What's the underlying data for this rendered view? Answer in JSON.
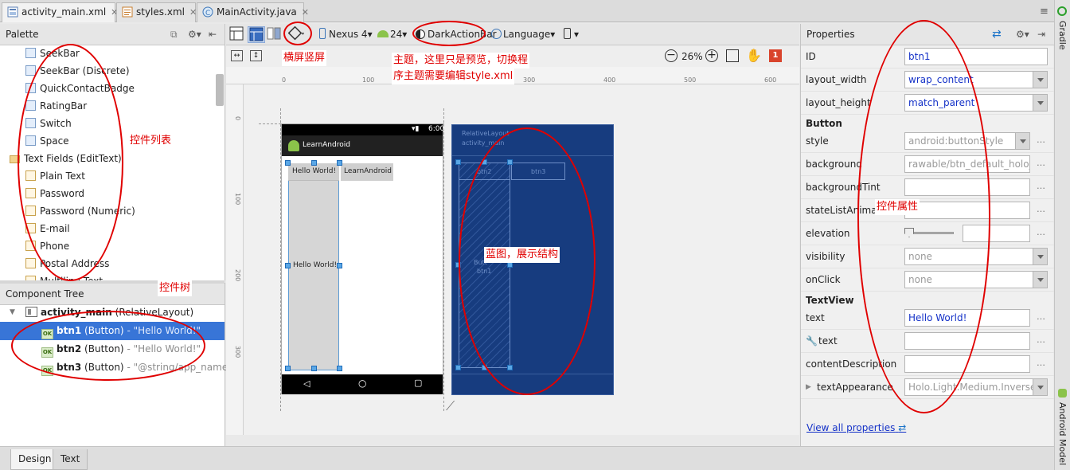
{
  "tabs": [
    {
      "label": "activity_main.xml",
      "icon": "layout-file-icon",
      "active": true
    },
    {
      "label": "styles.xml",
      "icon": "xml-file-icon",
      "active": false
    },
    {
      "label": "MainActivity.java",
      "icon": "java-class-icon",
      "active": false
    }
  ],
  "palette": {
    "title": "Palette",
    "items": [
      "SeekBar",
      "SeekBar (Discrete)",
      "QuickContactBadge",
      "RatingBar",
      "Switch",
      "Space",
      "Text Fields (EditText)",
      "Plain Text",
      "Password",
      "Password (Numeric)",
      "E-mail",
      "Phone",
      "Postal Address",
      "Multiline Text"
    ]
  },
  "component_tree": {
    "title": "Component Tree",
    "root": {
      "name": "activity_main",
      "type": "(RelativeLayout)"
    },
    "children": [
      {
        "name": "btn1",
        "type": "(Button)",
        "value": "- \"Hello World!\"",
        "selected": true
      },
      {
        "name": "btn2",
        "type": "(Button)",
        "value": "- \"Hello World!\"",
        "selected": false
      },
      {
        "name": "btn3",
        "type": "(Button)",
        "value": "- \"@string/app_name\"",
        "selected": false
      }
    ]
  },
  "toolbar": {
    "device": "Nexus 4",
    "api": "24",
    "theme": "DarkActionBar",
    "language": "Language",
    "zoom": "26%",
    "error_count": "1"
  },
  "ruler": {
    "top": [
      "0",
      "100",
      "200",
      "300",
      "400",
      "500",
      "600",
      "700",
      "800"
    ],
    "left": [
      "0",
      "100",
      "200",
      "300"
    ]
  },
  "preview": {
    "status_time": "6:00",
    "app_title": "LearnAndroid",
    "btn_hello_top": "Hello World!",
    "btn_learn": "LearnAndroid",
    "btn_hello_tall": "Hello World!"
  },
  "blueprint": {
    "layout_label": "RelativeLayout",
    "layout_id": "activity_main",
    "btn2": "btn2",
    "btn3": "btn3",
    "btn1_a": "Butt",
    "btn1_b": "btn1"
  },
  "properties": {
    "title": "Properties",
    "id_label": "ID",
    "id_value": "btn1",
    "lw_label": "layout_width",
    "lw_value": "wrap_content",
    "lh_label": "layout_height",
    "lh_value": "match_parent",
    "sec_button": "Button",
    "style_label": "style",
    "style_value": "android:buttonStyle",
    "bg_label": "background",
    "bg_value": "rawable/btn_default_holo_li",
    "bgtint_label": "backgroundTint",
    "sla_label": "stateListAnimato",
    "elev_label": "elevation",
    "vis_label": "visibility",
    "vis_value": "none",
    "onclick_label": "onClick",
    "onclick_value": "none",
    "sec_textview": "TextView",
    "text_label": "text",
    "text_value": "Hello World!",
    "tools_text_label": "text",
    "cd_label": "contentDescription",
    "ta_label": "textAppearance",
    "ta_value": "Holo.Light.Medium.Inverse",
    "view_all": "View all properties"
  },
  "bottom_tabs": [
    "Design",
    "Text"
  ],
  "gutter": {
    "top": "Gradle",
    "bottom": "Android Model"
  },
  "annotations": {
    "orientation": "横屏竖屏",
    "theme_line1": "主题，这里只是预览，切换程",
    "theme_line2": "序主题需要编辑style.xml",
    "widget_list": "控件列表",
    "widget_tree": "控件树",
    "blueprint": "蓝图，展示结构",
    "props": "控件属性"
  },
  "colors": {
    "selection": "#3875d7",
    "blueprint_bg": "#173c7f",
    "annotation": "#e00000",
    "link": "#1532c8"
  }
}
